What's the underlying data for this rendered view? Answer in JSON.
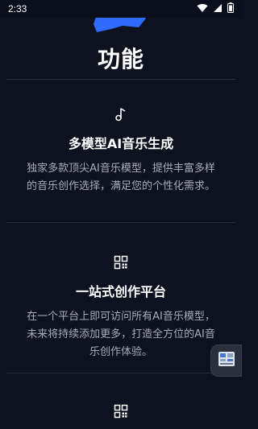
{
  "status_bar": {
    "time": "2:33",
    "icons": [
      "wifi-icon",
      "signal-icon",
      "battery-icon"
    ]
  },
  "page": {
    "title": "功能",
    "accent_color": "#2f6bff",
    "background_color": "#0d1120"
  },
  "features": [
    {
      "icon": "music-note-icon",
      "title": "多模型AI音乐生成",
      "description": "独家多款顶尖AI音乐模型，提供丰富多样的音乐创作选择，满足您的个性化需求。"
    },
    {
      "icon": "grid-apps-icon",
      "title": "一站式创作平台",
      "description": "在一个平台上即可访问所有AI音乐模型，未来将持续添加更多，打造全方位的AI音乐创作体验。"
    },
    {
      "icon": "grid-apps-icon"
    }
  ],
  "floating_button": {
    "icon": "app-switch-icon"
  }
}
